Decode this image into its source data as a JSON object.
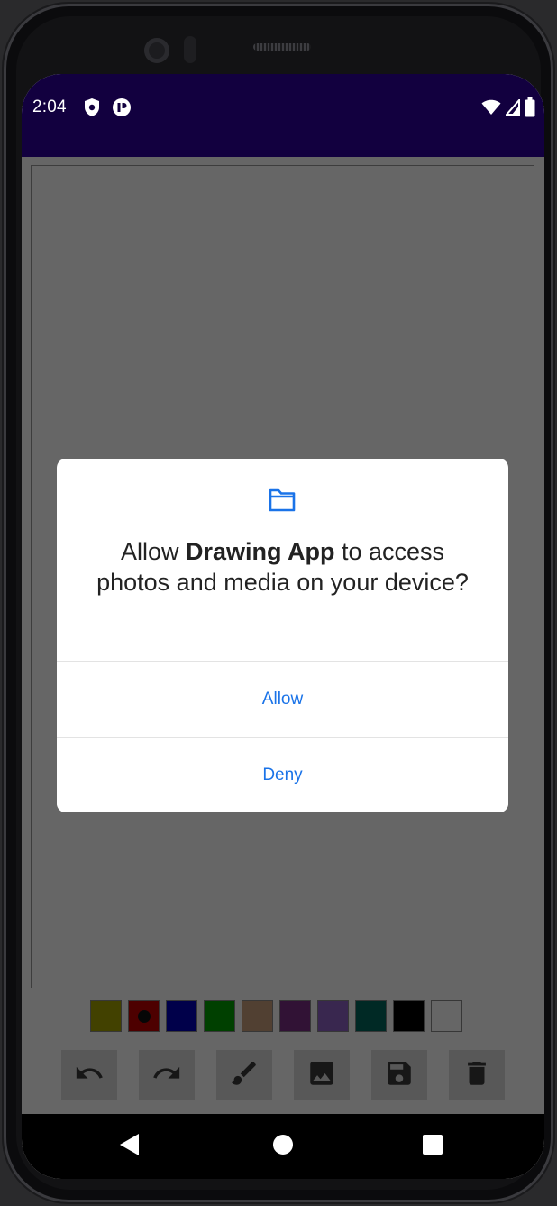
{
  "status_bar": {
    "time": "2:04",
    "left_icons": [
      "shield-icon",
      "app-badge-icon"
    ],
    "right_icons": [
      "wifi-icon",
      "signal-icon",
      "battery-icon"
    ],
    "background": "#12003f"
  },
  "palette": {
    "colors": [
      "#a5a200",
      "#c00000",
      "#0000b8",
      "#00a000",
      "#caa07e",
      "#7b2f86",
      "#8f61c6",
      "#00665e",
      "#000000",
      "#ffffff"
    ],
    "selected_index": 1
  },
  "toolbar": {
    "tools": [
      "undo-icon",
      "redo-icon",
      "brush-icon",
      "image-icon",
      "save-icon",
      "delete-icon"
    ]
  },
  "dialog": {
    "icon": "folder-icon",
    "message_prefix": "Allow ",
    "app_name": "Drawing App",
    "message_suffix": " to access photos and media on your device?",
    "allow_label": "Allow",
    "deny_label": "Deny",
    "accent": "#1a73e8"
  },
  "nav_bar": {
    "buttons": [
      "back-icon",
      "home-icon",
      "recents-icon"
    ]
  }
}
